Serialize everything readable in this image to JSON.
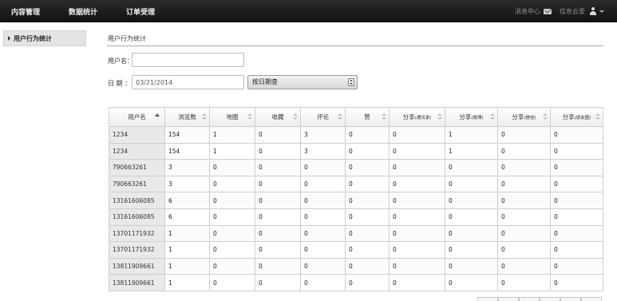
{
  "topnav": {
    "items": [
      "内容管理",
      "数据统计",
      "订单受理"
    ]
  },
  "topright": {
    "messages": "消息中心",
    "cloud": "信息云爱"
  },
  "sidebar": {
    "items": [
      {
        "label": "用户行为统计"
      }
    ]
  },
  "page": {
    "title": "用户行为统计",
    "username_label": "用户名：",
    "username_value": "",
    "date_label": "日 期 ：",
    "date_value": "03/21/2014",
    "mode_select": "按日期查"
  },
  "table": {
    "headers": [
      {
        "label": "用户名"
      },
      {
        "label": "浏览数"
      },
      {
        "label": "地图"
      },
      {
        "label": "收藏"
      },
      {
        "label": "评论"
      },
      {
        "label": "赞"
      },
      {
        "label": "分享",
        "sub": "(通讯录)"
      },
      {
        "label": "分享",
        "sub": "(微博)"
      },
      {
        "label": "分享",
        "sub": "(微信)"
      },
      {
        "label": "分享",
        "sub": "(朋友圈)"
      }
    ],
    "rows": [
      [
        "1234",
        "154",
        "1",
        "0",
        "3",
        "0",
        "0",
        "1",
        "0",
        "0"
      ],
      [
        "1234",
        "154",
        "1",
        "0",
        "3",
        "0",
        "0",
        "1",
        "0",
        "0"
      ],
      [
        "790663261",
        "3",
        "0",
        "0",
        "0",
        "0",
        "0",
        "0",
        "0",
        "0"
      ],
      [
        "790663261",
        "3",
        "0",
        "0",
        "0",
        "0",
        "0",
        "0",
        "0",
        "0"
      ],
      [
        "13161606085",
        "6",
        "0",
        "0",
        "0",
        "0",
        "0",
        "0",
        "0",
        "0"
      ],
      [
        "13161606085",
        "6",
        "0",
        "0",
        "0",
        "0",
        "0",
        "0",
        "0",
        "0"
      ],
      [
        "13701171932",
        "1",
        "0",
        "0",
        "0",
        "0",
        "0",
        "0",
        "0",
        "0"
      ],
      [
        "13701171932",
        "1",
        "0",
        "0",
        "0",
        "0",
        "0",
        "0",
        "0",
        "0"
      ],
      [
        "13811909661",
        "1",
        "0",
        "0",
        "0",
        "0",
        "0",
        "0",
        "0",
        "0"
      ],
      [
        "13811909661",
        "1",
        "0",
        "0",
        "0",
        "0",
        "0",
        "0",
        "0",
        "0"
      ]
    ]
  }
}
